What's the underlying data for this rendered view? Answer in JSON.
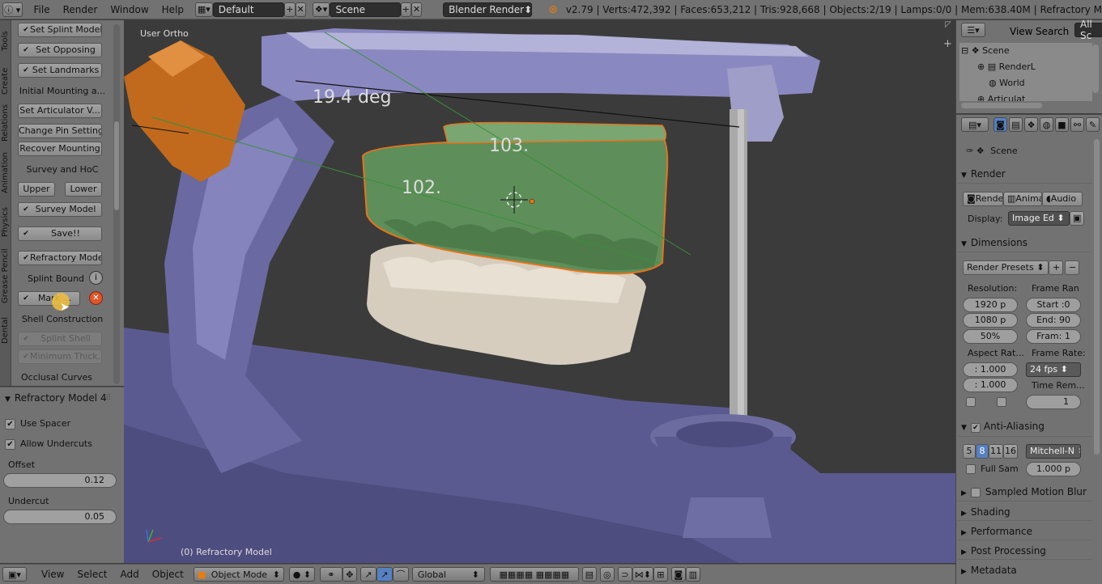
{
  "topbar": {
    "menus": [
      "File",
      "Render",
      "Window",
      "Help"
    ],
    "layout": "Default",
    "scene": "Scene",
    "engine": "Blender Render",
    "stats": "v2.79 | Verts:472,392 | Faces:653,212 | Tris:928,668 | Objects:2/19 | Lamps:0/0 | Mem:638.40M | Refractory M"
  },
  "tabs": [
    "Tools",
    "Create",
    "Relations",
    "Animation",
    "Physics",
    "Grease Pencil",
    "Dental"
  ],
  "shelf": {
    "set_splint_model": "Set Splint Model",
    "set_opposing": "Set Opposing",
    "set_landmarks": "Set Landmarks",
    "initial_mounting": "Initial Mounting a...",
    "set_articulator": "Set Articulator V...",
    "change_pin": "Change Pin Setting",
    "recover_mounting": "Recover Mounting",
    "survey_hoc": "Survey and HoC",
    "upper": "Upper",
    "lower": "Lower",
    "survey_model": "Survey Model",
    "save": "Save!!",
    "refractory_model": "Refractory Model",
    "splint_bound": "Splint Bound",
    "mark": "Mark ...",
    "shell_construction": "Shell Construction",
    "splint_shell": "Splint Shell",
    "minimum_thick": "Minimum Thick...",
    "occlusal_curves": "Occlusal Curves"
  },
  "redo": {
    "title": "Refractory Model 4",
    "use_spacer": "Use Spacer",
    "allow_undercuts": "Allow Undercuts",
    "offset_label": "Offset",
    "offset_value": "0.12",
    "undercut_label": "Undercut",
    "undercut_value": "0.05"
  },
  "viewport": {
    "view_label": "User Ortho",
    "angle": "19.4 deg",
    "label_a": "103.",
    "label_b": "102.",
    "object_label": "(0) Refractory Model"
  },
  "bottombar": {
    "menus": [
      "View",
      "Select",
      "Add",
      "Object"
    ],
    "mode": "Object Mode",
    "orientation": "Global"
  },
  "outliner": {
    "view": "View",
    "search": "Search",
    "filter": "All Sc",
    "items": [
      "Scene",
      "RenderL",
      "World",
      "Articulat"
    ]
  },
  "props": {
    "context": "Scene",
    "render_hdr": "Render",
    "render_btn": "Rende",
    "anim_btn": "Anima",
    "audio_btn": "Audio",
    "display_label": "Display:",
    "display_value": "Image Ed",
    "dimensions_hdr": "Dimensions",
    "presets": "Render Presets",
    "resolution_label": "Resolution:",
    "frame_range_label": "Frame Ran",
    "res_x": "1920 p",
    "res_y": "1080 p",
    "res_pct": "50%",
    "start": "Start :0",
    "end": "End: 90",
    "fram": "Fram: 1",
    "aspect_label": "Aspect Rat...",
    "frame_rate_label": "Frame Rate:",
    "aspect_x": ": 1.000",
    "aspect_y": ": 1.000",
    "fps": "24 fps",
    "time_rem_label": "Time Rem...",
    "time_rem_value": "1",
    "aa_hdr": "Anti-Aliasing",
    "aa_5": "5",
    "aa_8": "8",
    "aa_11": "11",
    "aa_16": "16",
    "aa_filter": "Mitchell-N",
    "full_sample": "Full Sam",
    "aa_size": "1.000 p",
    "smb_hdr": "Sampled Motion Blur",
    "shading_hdr": "Shading",
    "performance_hdr": "Performance",
    "post_hdr": "Post Processing",
    "metadata_hdr": "Metadata"
  }
}
